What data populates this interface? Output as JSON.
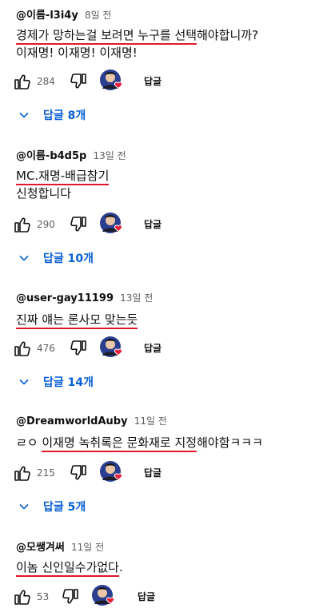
{
  "comments": [
    {
      "author": "@이름-l3i4y",
      "time": "8일 전",
      "lines": [
        {
          "pre": "",
          "hl": "경제가 망하는걸 보려면 누구를 선택",
          "post": "해야합니까?"
        },
        {
          "pre": "이재명! 이재명! 이재명!",
          "hl": "",
          "post": ""
        }
      ],
      "likes": "284",
      "reply_label": "답글",
      "replies_label": "답글 8개"
    },
    {
      "author": "@이름-b4d5p",
      "time": "13일 전",
      "lines": [
        {
          "pre": "",
          "hl": "MC.재명-배급참기",
          "post": ""
        },
        {
          "pre": "신청합니다",
          "hl": "",
          "post": ""
        }
      ],
      "likes": "290",
      "reply_label": "답글",
      "replies_label": "답글 10개"
    },
    {
      "author": "@user-gay11199",
      "time": "13일 전",
      "lines": [
        {
          "pre": "",
          "hl": "진짜 얘는 론사모 맞는듯",
          "post": ""
        }
      ],
      "likes": "476",
      "reply_label": "답글",
      "replies_label": "답글 14개"
    },
    {
      "author": "@DreamworldAuby",
      "time": "11일 전",
      "lines": [
        {
          "pre": "ㄹㅇ ",
          "hl": "이재명 녹취록은 문화재로 지정",
          "post": "해야함ㅋㅋㅋ"
        }
      ],
      "likes": "215",
      "reply_label": "답글",
      "replies_label": "답글 5개"
    },
    {
      "author": "@모쌩겨써",
      "time": "11일 전",
      "lines": [
        {
          "pre": "",
          "hl": "이놈 신인일수가없다",
          "post": "."
        }
      ],
      "likes": "53",
      "reply_label": "답글",
      "replies_label": ""
    }
  ],
  "icons": {
    "like": "thumbs-up-icon",
    "dislike": "thumbs-down-icon",
    "heart": "creator-heart-icon",
    "chevron": "chevron-down-icon"
  },
  "colors": {
    "reply_link": "#065fd4",
    "highlight_underline": "#e0182d",
    "heart": "#e3203b",
    "avatar_bg": "#2a3f8f"
  }
}
